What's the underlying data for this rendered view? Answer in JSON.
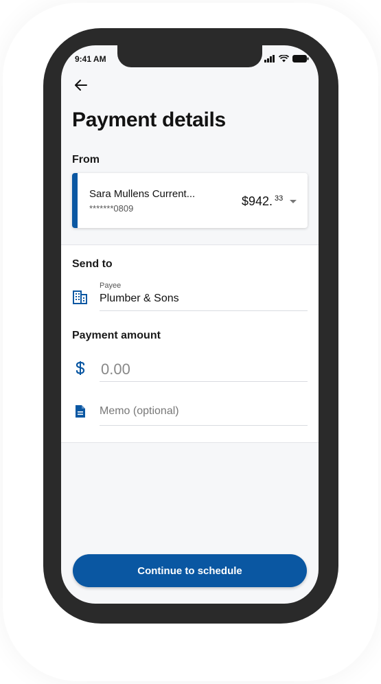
{
  "status_bar": {
    "time": "9:41 AM"
  },
  "page": {
    "title": "Payment details"
  },
  "from": {
    "label": "From",
    "account": {
      "name": "Sara Mullens Current...",
      "number": "*******0809",
      "balance_main": "$942.",
      "balance_cents": "33"
    }
  },
  "send_to": {
    "label": "Send to",
    "payee": {
      "label": "Payee",
      "value": "Plumber & Sons",
      "icon": "building-icon"
    }
  },
  "payment_amount": {
    "label": "Payment amount",
    "amount": {
      "placeholder": "0.00",
      "icon": "dollar-icon"
    },
    "memo": {
      "placeholder": "Memo (optional)",
      "icon": "document-icon"
    }
  },
  "actions": {
    "continue_label": "Continue to schedule"
  },
  "colors": {
    "accent": "#0a57a2",
    "frame": "#2a2a2a",
    "background": "#f6f7f9"
  }
}
